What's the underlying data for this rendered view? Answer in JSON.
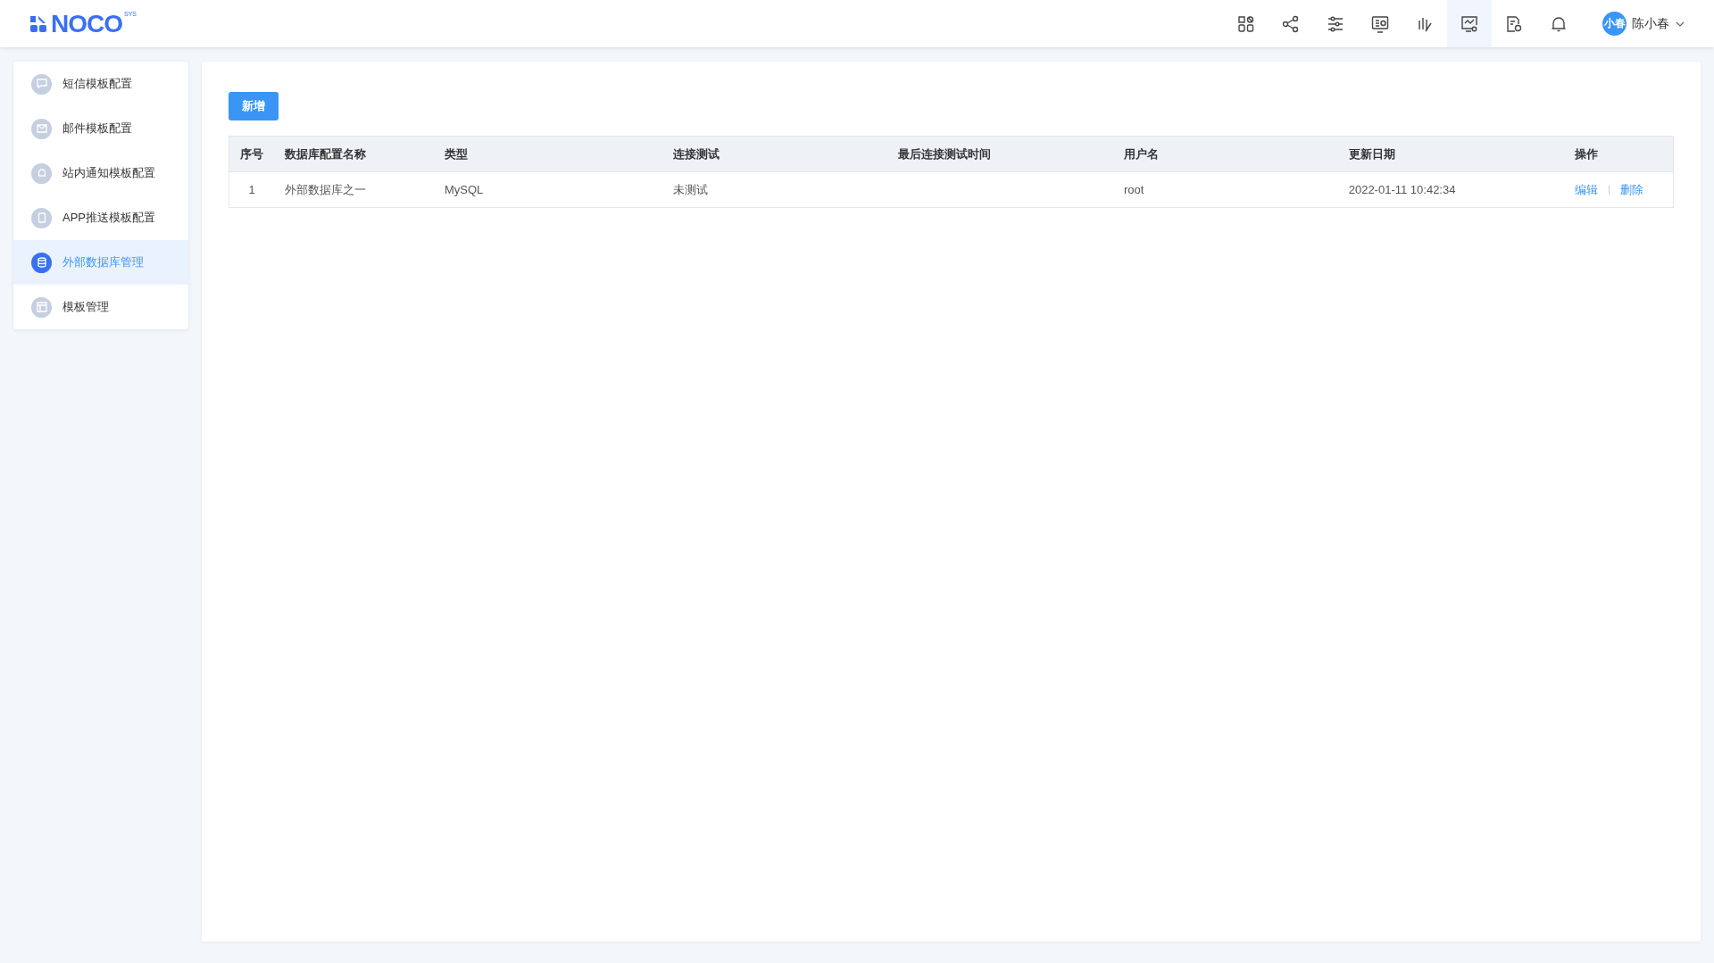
{
  "header": {
    "logo": {
      "text": "NOCO",
      "sup": "SYS"
    },
    "tools": [
      {
        "kind": "apps",
        "selected": false
      },
      {
        "kind": "share",
        "selected": false
      },
      {
        "kind": "sliders",
        "selected": false
      },
      {
        "kind": "monitor-chart",
        "selected": false
      },
      {
        "kind": "bars-pen",
        "selected": false
      },
      {
        "kind": "monitor-gear",
        "selected": true
      },
      {
        "kind": "doc-gear",
        "selected": false
      },
      {
        "kind": "bell",
        "selected": false
      }
    ],
    "user": {
      "avatar": "小春",
      "name": "陈小春"
    }
  },
  "sidebar": {
    "items": [
      {
        "kind": "sms",
        "label": "短信模板配置",
        "selected": false
      },
      {
        "kind": "mail",
        "label": "邮件模板配置",
        "selected": false
      },
      {
        "kind": "bell",
        "label": "站内通知模板配置",
        "selected": false
      },
      {
        "kind": "phone",
        "label": "APP推送模板配置",
        "selected": false
      },
      {
        "kind": "database",
        "label": "外部数据库管理",
        "selected": true
      },
      {
        "kind": "template",
        "label": "模板管理",
        "selected": false
      }
    ]
  },
  "toolbar": {
    "add_button": "新增"
  },
  "table": {
    "columns": [
      "序号",
      "数据库配置名称",
      "类型",
      "连接测试",
      "最后连接测试时间",
      "用户名",
      "更新日期",
      "操作"
    ],
    "rows": [
      {
        "cells": [
          "1",
          "外部数据库之一",
          "MySQL",
          "未测试",
          "",
          "root",
          "2022-01-11 10:42:34"
        ],
        "actions": [
          "编辑",
          "删除"
        ]
      }
    ]
  }
}
